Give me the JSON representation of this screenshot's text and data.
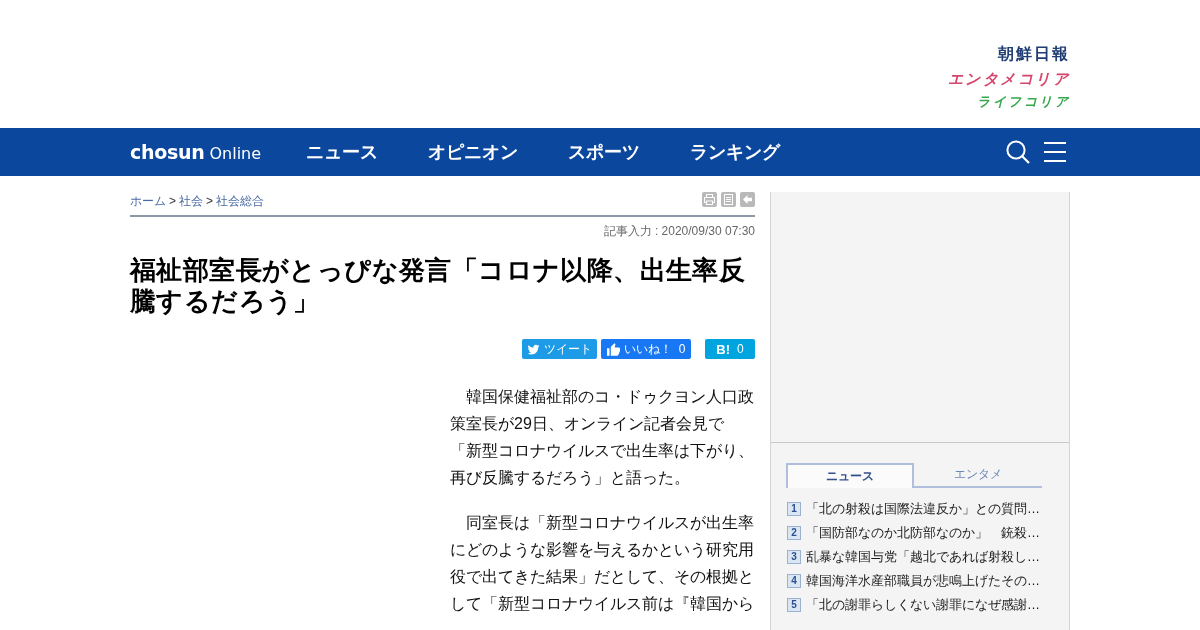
{
  "header": {
    "logos": [
      {
        "kind": "newspaper",
        "text": "朝鮮日報"
      },
      {
        "kind": "entertainment",
        "text": "エンタメコリア"
      },
      {
        "kind": "life",
        "text": "ライフコリア"
      }
    ]
  },
  "nav": {
    "logo": "**chosun** Online",
    "items": [
      {
        "label": "ニュース"
      },
      {
        "label": "オピニオン"
      },
      {
        "label": "スポーツ"
      },
      {
        "label": "ランキング"
      }
    ]
  },
  "breadcrumb": [
    {
      "kind": "link",
      "text": "ホーム"
    },
    {
      "kind": "separator",
      "text": ">"
    },
    {
      "kind": "link",
      "text": "社会"
    },
    {
      "kind": "separator",
      "text": ">"
    },
    {
      "kind": "link",
      "text": "社会総合"
    }
  ],
  "article": {
    "timestamp": "記事入力 : 2020/09/30 07:30",
    "title": "福祉部室長がとっぴな発言「コロナ以降、出生率反騰するだろう」",
    "share_buttons": [
      {
        "kind": "tweet",
        "label": "ツイート"
      },
      {
        "kind": "like",
        "label": "いいね！",
        "count": "0"
      },
      {
        "kind": "hatena",
        "label": "B!",
        "count": "0"
      }
    ],
    "paragraphs": [
      "韓国保健福祉部のコ・ドゥクヨン人口政策室長が29日、オンライン記者会見で「新型コロナウイルスで出生率は下がり、再び反騰するだろう」と語った。",
      "同室長は「新型コロナウイルスが出生率にどのような影響を与えるかという研究用役で出てきた結果」だとして、その根拠として「新型コロナウイルス前は『韓国から"
    ]
  },
  "sidebar": {
    "ranking": {
      "tabs": [
        {
          "label": "ニュース",
          "selected": true
        },
        {
          "label": "エンタメ",
          "selected": false
        }
      ],
      "items": [
        {
          "rank": "1",
          "headline": "「北の射殺は国際法違反か」との質問…"
        },
        {
          "rank": "2",
          "headline": "「国防部なのか北防部なのか」　銃殺…"
        },
        {
          "rank": "3",
          "headline": "乱暴な韓国与党「越北であれば射殺し…"
        },
        {
          "rank": "4",
          "headline": "韓国海洋水産部職員が悲鳴上げたその…"
        },
        {
          "rank": "5",
          "headline": "「北の謝罪らしくない謝罪になぜ感謝…"
        }
      ]
    }
  }
}
